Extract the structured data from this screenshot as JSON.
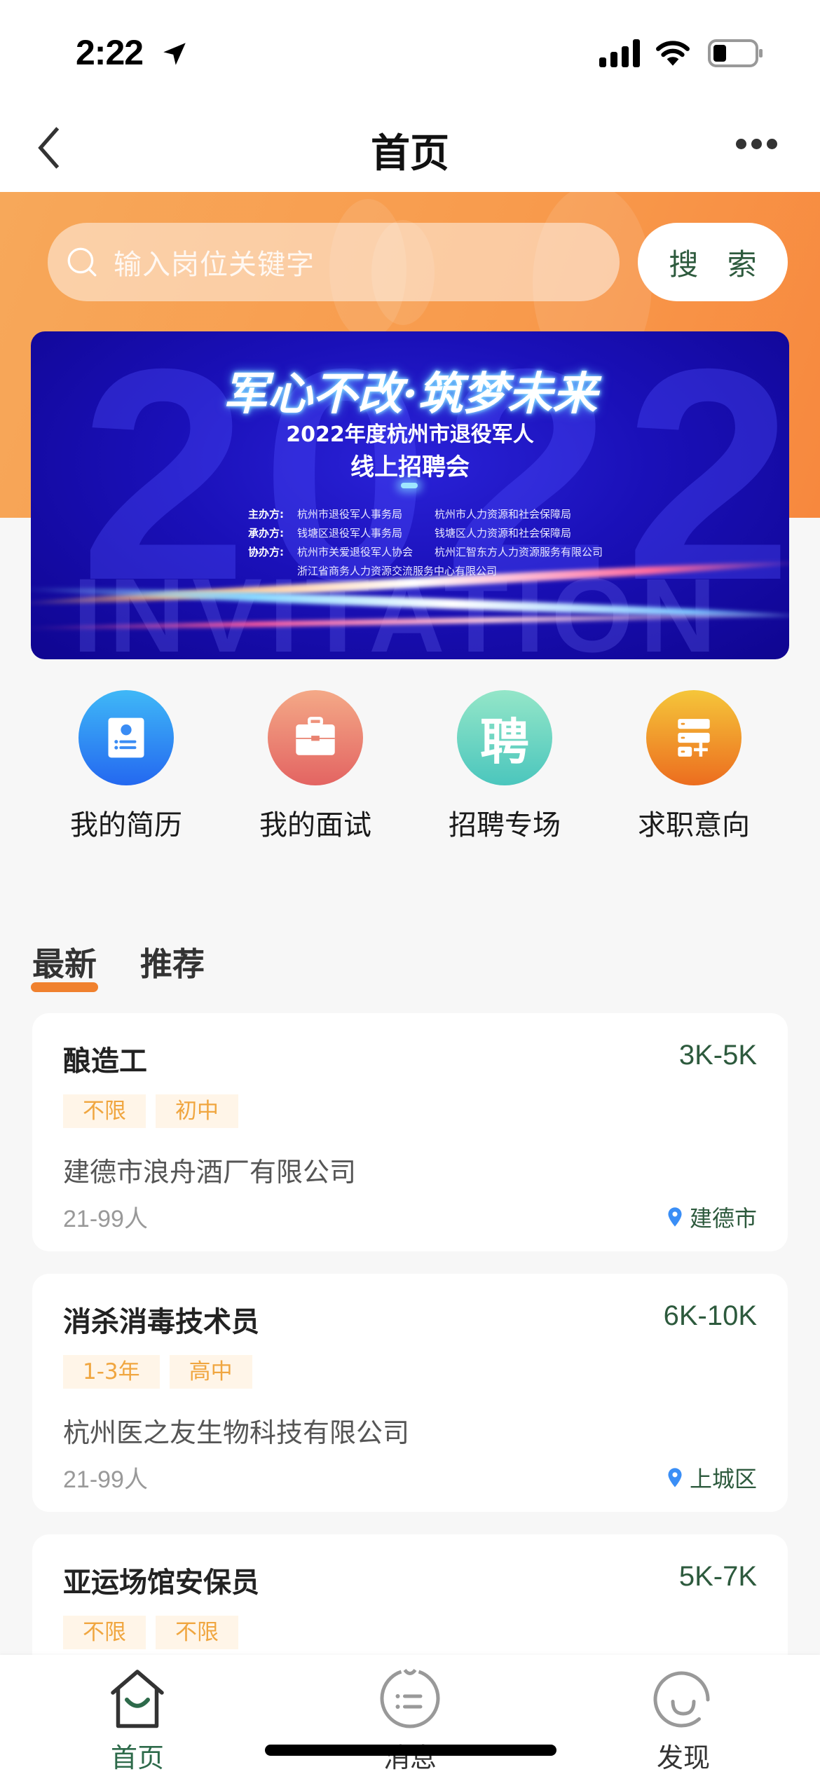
{
  "status_bar": {
    "time": "2:22",
    "icons": [
      "location-arrow-icon",
      "cellular-signal-icon",
      "wifi-icon",
      "battery-icon"
    ]
  },
  "nav": {
    "title": "首页",
    "back_icon": "chevron-left-icon",
    "more_icon": "more-horizontal-icon"
  },
  "search": {
    "placeholder": "输入岗位关键字",
    "button_label": "搜 索",
    "icon": "search-icon"
  },
  "banner": {
    "slogan": "军心不改·筑梦未来",
    "subtitle_line1": "2022年度杭州市退役军人",
    "subtitle_line2": "线上招聘会",
    "bg_year": "2022",
    "bg_word": "INVITATION",
    "organizers": [
      {
        "role": "主办方:",
        "a": "杭州市退役军人事务局",
        "b": "杭州市人力资源和社会保障局"
      },
      {
        "role": "承办方:",
        "a": "钱塘区退役军人事务局",
        "b": "钱塘区人力资源和社会保障局"
      },
      {
        "role": "协办方:",
        "a": "杭州市关爱退役军人协会",
        "b": "杭州汇智东方人力资源服务有限公司"
      }
    ],
    "organizer_extra": "浙江省商务人力资源交流服务中心有限公司"
  },
  "quick_actions": [
    {
      "label": "我的简历",
      "icon": "resume-icon",
      "color_top": "#3fb8f7",
      "color_bottom": "#2468f0"
    },
    {
      "label": "我的面试",
      "icon": "briefcase-icon",
      "color_top": "#f4a987",
      "color_bottom": "#e36462"
    },
    {
      "label": "招聘专场",
      "icon": "recruit-char-icon",
      "glyph": "聘",
      "color_top": "#94e6c8",
      "color_bottom": "#4bc6bd"
    },
    {
      "label": "求职意向",
      "icon": "job-intention-add-icon",
      "color_top": "#f5c63a",
      "color_bottom": "#ec6d1f"
    }
  ],
  "tabs": [
    {
      "label": "最新",
      "active": true
    },
    {
      "label": "推荐",
      "active": false
    }
  ],
  "jobs": [
    {
      "title": "酿造工",
      "salary": "3K-5K",
      "tags": [
        "不限",
        "初中"
      ],
      "company": "建德市浪舟酒厂有限公司",
      "size": "21-99人",
      "location": "建德市"
    },
    {
      "title": "消杀消毒技术员",
      "salary": "6K-10K",
      "tags": [
        "1-3年",
        "高中"
      ],
      "company": "杭州医之友生物科技有限公司",
      "size": "21-99人",
      "location": "上城区"
    },
    {
      "title": "亚运场馆安保员",
      "salary": "5K-7K",
      "tags": [
        "不限",
        "不限"
      ],
      "company": "",
      "size": "",
      "location": ""
    }
  ],
  "bottom_nav": [
    {
      "label": "首页",
      "icon": "home-icon",
      "active": true
    },
    {
      "label": "消息",
      "icon": "message-icon",
      "active": false
    },
    {
      "label": "发现",
      "icon": "discover-icon",
      "active": false
    }
  ],
  "colors": {
    "brand_orange": "#f89a4c",
    "accent_green": "#2d5a3d",
    "tag_text": "#f0a640",
    "tag_bg": "#fff5e8",
    "pin_blue": "#3a8ef6"
  }
}
